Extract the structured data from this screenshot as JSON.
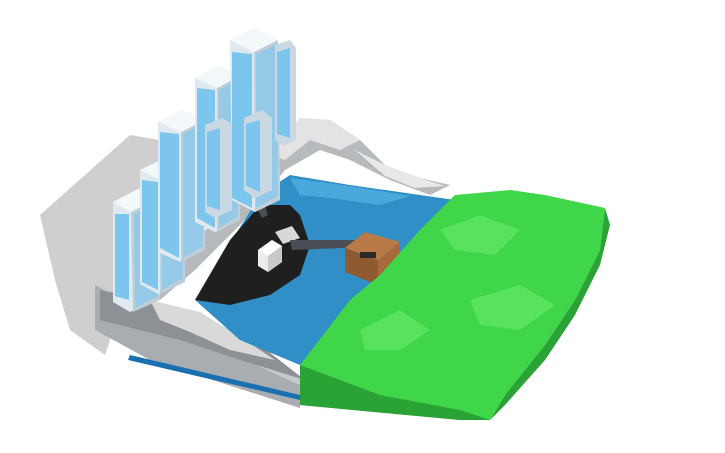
{
  "canvas": {
    "background": "#ffffff"
  },
  "scene": {
    "objects": [
      "shadow",
      "concrete-base",
      "left-rock-cliff",
      "back-rock-wall",
      "right-rock-ledge",
      "reservoir-water",
      "dark-island",
      "outflow-pipe",
      "white-pump-house",
      "connecting-pipe",
      "brown-box",
      "stream-channel",
      "blue-pipe",
      "green-grass-terrain",
      "city-towers"
    ],
    "colors": {
      "shadow": "#c9c9c9",
      "concrete": "#b4b8bc",
      "concrete_dark": "#8f9398",
      "rock_light": "#dcdcdc",
      "rock_dark": "#6c6f73",
      "water": "#2f8fc6",
      "water_light": "#4ba8da",
      "island": "#1f1f20",
      "pipe": "#4a4f55",
      "pump_house": "#f2f2f2",
      "box": "#a86a3c",
      "blue_pipe": "#1a6fb0",
      "grass": "#3fd64a",
      "grass_dark": "#2aa236",
      "tower_face": "#e6f3fb",
      "tower_window": "#7cc6ee",
      "tower_side": "#c9d6df"
    }
  }
}
